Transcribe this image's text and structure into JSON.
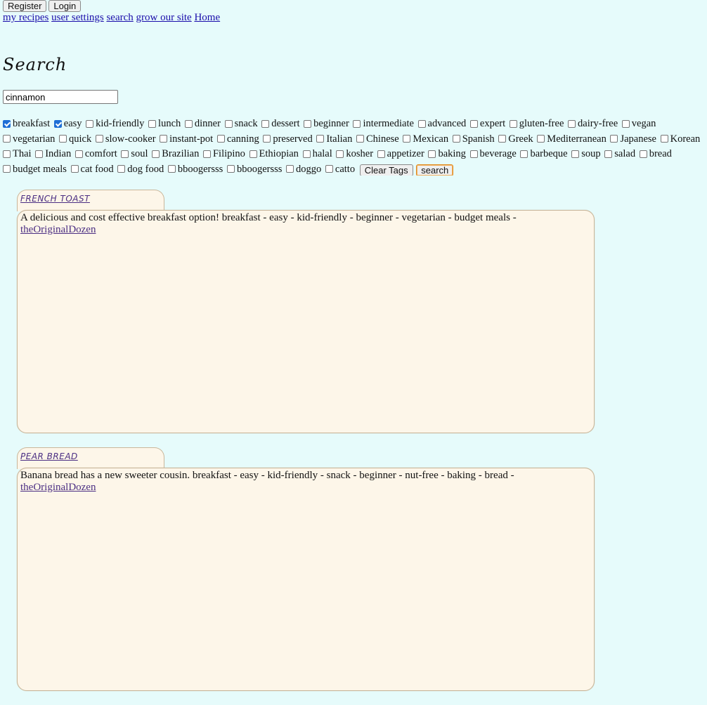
{
  "auth": {
    "register_label": "Register",
    "login_label": "Login"
  },
  "nav": {
    "my_recipes": "my recipes",
    "user_settings": "user settings",
    "search": "search",
    "grow": "grow our site",
    "home": "Home"
  },
  "page_title": "Search",
  "search": {
    "value": "cinnamon"
  },
  "tags": [
    {
      "label": "breakfast",
      "checked": true
    },
    {
      "label": "easy",
      "checked": true
    },
    {
      "label": "kid-friendly",
      "checked": false
    },
    {
      "label": "lunch",
      "checked": false
    },
    {
      "label": "dinner",
      "checked": false
    },
    {
      "label": "snack",
      "checked": false
    },
    {
      "label": "dessert",
      "checked": false
    },
    {
      "label": "beginner",
      "checked": false
    },
    {
      "label": "intermediate",
      "checked": false
    },
    {
      "label": "advanced",
      "checked": false
    },
    {
      "label": "expert",
      "checked": false
    },
    {
      "label": "gluten-free",
      "checked": false
    },
    {
      "label": "dairy-free",
      "checked": false
    },
    {
      "label": "vegan",
      "checked": false
    },
    {
      "label": "vegetarian",
      "checked": false
    },
    {
      "label": "quick",
      "checked": false
    },
    {
      "label": "slow-cooker",
      "checked": false
    },
    {
      "label": "instant-pot",
      "checked": false
    },
    {
      "label": "canning",
      "checked": false
    },
    {
      "label": "preserved",
      "checked": false
    },
    {
      "label": "Italian",
      "checked": false
    },
    {
      "label": "Chinese",
      "checked": false
    },
    {
      "label": "Mexican",
      "checked": false
    },
    {
      "label": "Spanish",
      "checked": false
    },
    {
      "label": "Greek",
      "checked": false
    },
    {
      "label": "Mediterranean",
      "checked": false
    },
    {
      "label": "Japanese",
      "checked": false
    },
    {
      "label": "Korean",
      "checked": false
    },
    {
      "label": "Thai",
      "checked": false
    },
    {
      "label": "Indian",
      "checked": false
    },
    {
      "label": "comfort",
      "checked": false
    },
    {
      "label": "soul",
      "checked": false
    },
    {
      "label": "Brazilian",
      "checked": false
    },
    {
      "label": "Filipino",
      "checked": false
    },
    {
      "label": "Ethiopian",
      "checked": false
    },
    {
      "label": "halal",
      "checked": false
    },
    {
      "label": "kosher",
      "checked": false
    },
    {
      "label": "appetizer",
      "checked": false
    },
    {
      "label": "baking",
      "checked": false
    },
    {
      "label": "beverage",
      "checked": false
    },
    {
      "label": "barbeque",
      "checked": false
    },
    {
      "label": "soup",
      "checked": false
    },
    {
      "label": "salad",
      "checked": false
    },
    {
      "label": "bread",
      "checked": false
    },
    {
      "label": "budget meals",
      "checked": false
    },
    {
      "label": "cat food",
      "checked": false
    },
    {
      "label": "dog food",
      "checked": false
    },
    {
      "label": "bboogersss",
      "checked": false
    },
    {
      "label": "bboogersss",
      "checked": false
    },
    {
      "label": "doggo",
      "checked": false
    },
    {
      "label": "catto",
      "checked": false
    }
  ],
  "clear_tags_label": "Clear Tags",
  "search_button_label": "search",
  "results": [
    {
      "title": "FRENCH TOAST",
      "description": "A delicious and cost effective breakfast option! breakfast - easy - kid-friendly - beginner - vegetarian - budget meals -",
      "author": "theOriginalDozen"
    },
    {
      "title": "PEAR BREAD",
      "description": "Banana bread has a new sweeter cousin. breakfast - easy - kid-friendly - snack - beginner - nut-free - baking - bread -",
      "author": "theOriginalDozen"
    }
  ]
}
